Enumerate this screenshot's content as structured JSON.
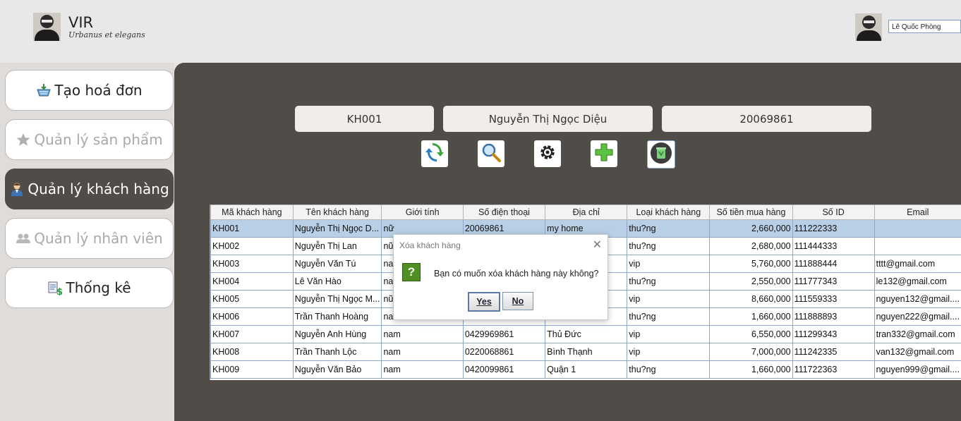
{
  "header": {
    "brand_title": "VIR",
    "brand_subtitle": "Urbanus et elegans",
    "user_name": "Lê Quốc Phòng"
  },
  "sidebar": {
    "items": [
      {
        "label": "Tạo hoá đơn",
        "icon": "basket-icon",
        "state": "normal"
      },
      {
        "label": "Quản lý sản phẩm",
        "icon": "star-icon",
        "state": "disabled"
      },
      {
        "label": "Quản lý khách hàng",
        "icon": "customer-icon",
        "state": "active"
      },
      {
        "label": "Quản lý nhân viên",
        "icon": "employees-icon",
        "state": "disabled"
      },
      {
        "label": "Thống kê",
        "icon": "statistics-icon",
        "state": "normal"
      }
    ]
  },
  "form": {
    "customer_id": "KH001",
    "customer_name": "Nguyễn Thị Ngọc Diệu",
    "phone": "20069861"
  },
  "toolbar": [
    "refresh-icon",
    "search-icon",
    "settings-icon",
    "add-icon",
    "delete-icon"
  ],
  "table": {
    "columns": [
      "Mã khách hàng",
      "Tên khách hàng",
      "Giới tính",
      "Số điện thoại",
      "Địa chỉ",
      "Loại khách hàng",
      "Số tiền mua hàng",
      "Số ID",
      "Email"
    ],
    "rows": [
      [
        "KH001",
        "Nguyễn Thị Ngọc D...",
        "nữ",
        "20069861",
        "my home",
        "thu?ng",
        "2,660,000",
        "111222333",
        ""
      ],
      [
        "KH002",
        "Nguyễn Thị Lan",
        "nữ",
        "",
        "",
        "thu?ng",
        "2,680,000",
        "111444333",
        ""
      ],
      [
        "KH003",
        "Nguyễn Văn Tú",
        "nam",
        "",
        "",
        "vip",
        "5,760,000",
        "111888444",
        "tttt@gmail.com"
      ],
      [
        "KH004",
        "Lê Văn Hào",
        "nam",
        "",
        "",
        "thu?ng",
        "2,550,000",
        "111777343",
        "le132@gmail.com"
      ],
      [
        "KH005",
        "Nguyễn Thị Ngọc M...",
        "nữ",
        "",
        "",
        "vip",
        "8,660,000",
        "111559333",
        "nguyen132@gmail...."
      ],
      [
        "KH006",
        "Trần Thanh Hoàng",
        "nam",
        "",
        "",
        "thu?ng",
        "1,660,000",
        "111888893",
        "nguyen222@gmail...."
      ],
      [
        "KH007",
        "Nguyễn Anh Hùng",
        "nam",
        "0429969861",
        "Thủ Đức",
        "vip",
        "6,550,000",
        "111299343",
        "tran332@gmail.com"
      ],
      [
        "KH008",
        "Trần Thanh Lộc",
        "nam",
        "0220068861",
        "Bình Thạnh",
        "vip",
        "7,000,000",
        "111242335",
        "van132@gmail.com"
      ],
      [
        "KH009",
        "Nguyễn Văn Bảo",
        "nam",
        "0420099861",
        "Quận 1",
        "thu?ng",
        "1,660,000",
        "111722363",
        "nguyen999@gmail...."
      ]
    ],
    "selected_row": 0
  },
  "dialog": {
    "title": "Xóa khách hàng",
    "message": "Bạn có muốn xóa khách hàng này không?",
    "yes_label": "Yes",
    "no_label": "No",
    "icon_glyph": "?"
  }
}
